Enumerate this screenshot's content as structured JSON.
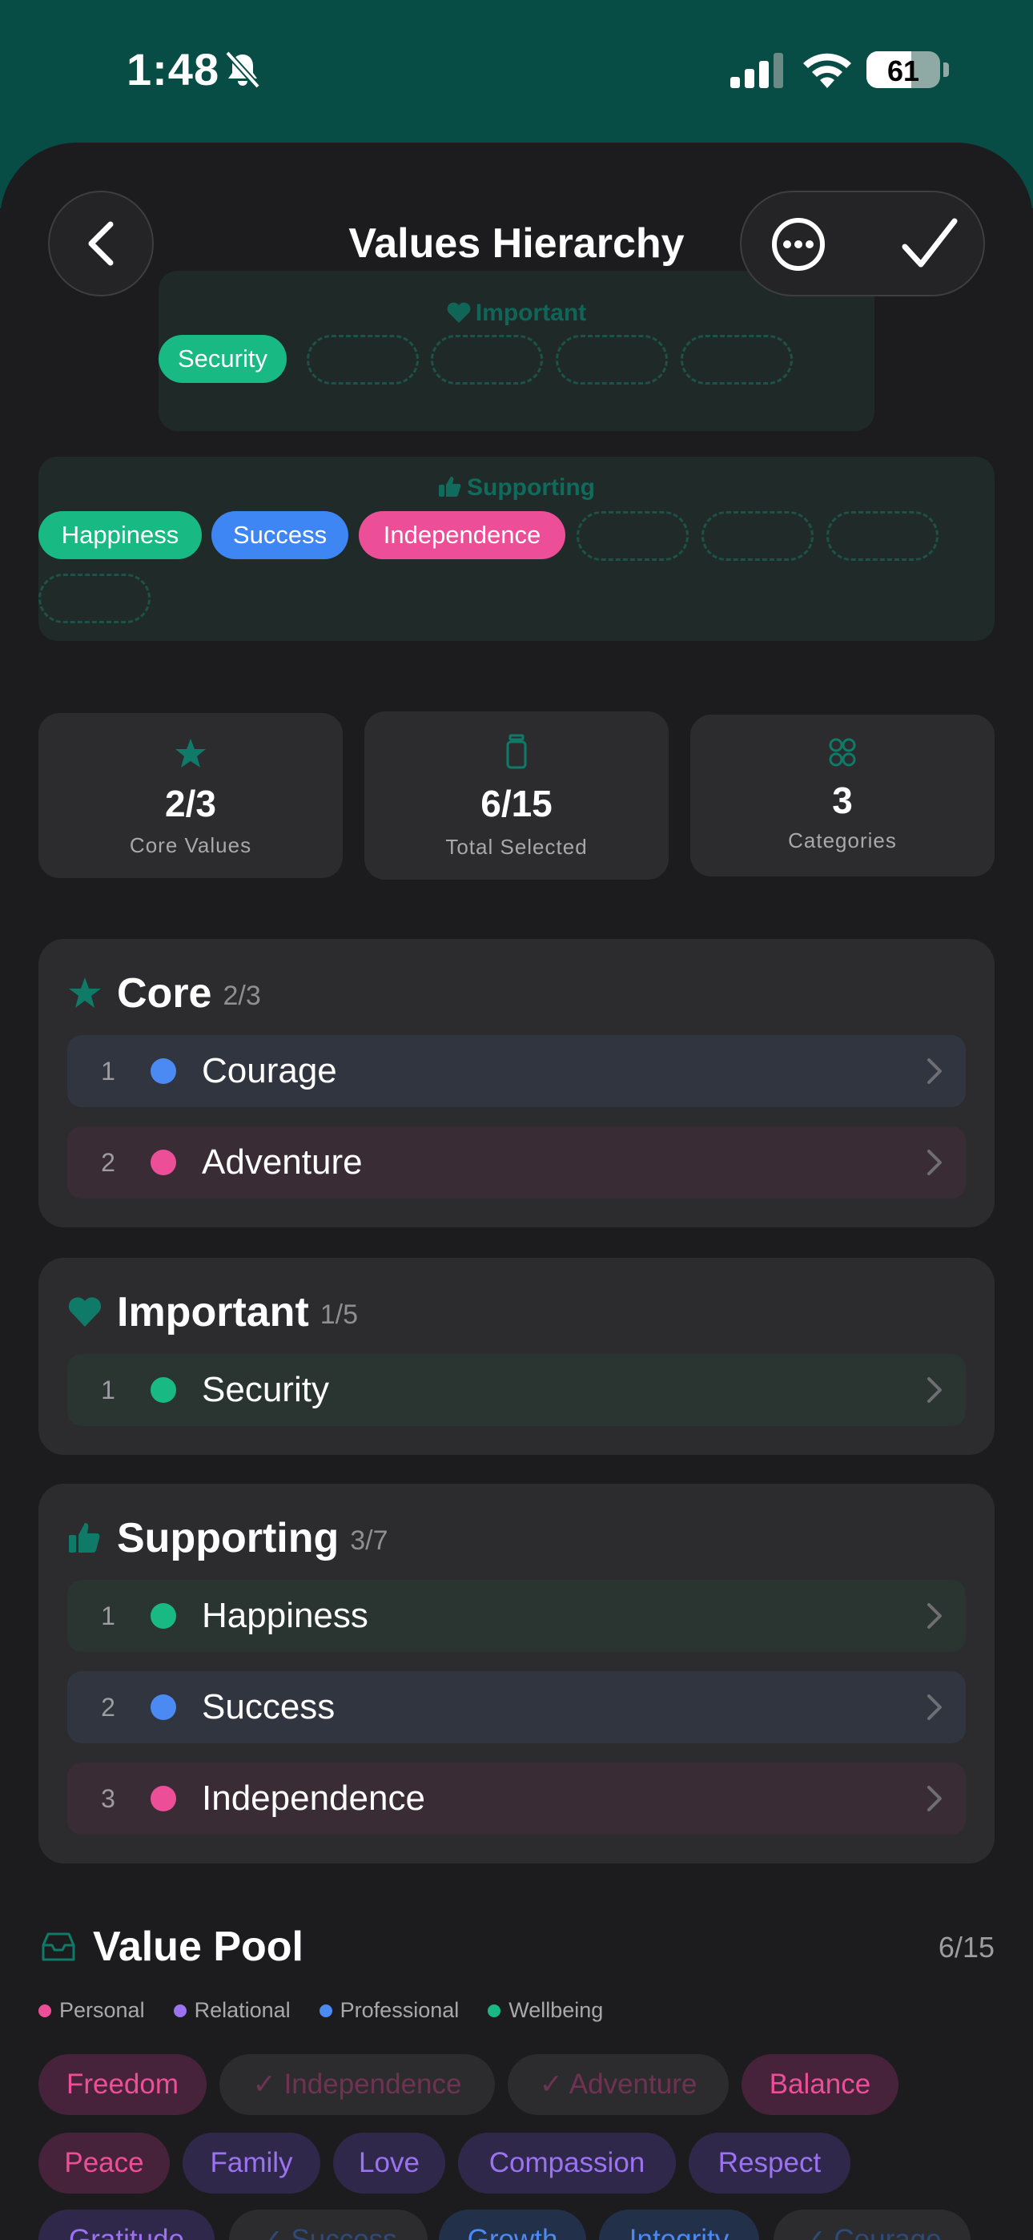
{
  "status_bar": {
    "time": "1:48",
    "battery": "61"
  },
  "header": {
    "title": "Values Hierarchy"
  },
  "pyramid": {
    "important_label": "Important",
    "important_chips": [
      "Security"
    ],
    "supporting_label": "Supporting",
    "supporting_chips": [
      "Happiness",
      "Success",
      "Independence"
    ]
  },
  "stats": [
    {
      "value": "2/3",
      "label": "Core Values",
      "icon": "star-icon"
    },
    {
      "value": "6/15",
      "label": "Total Selected",
      "icon": "jar-icon"
    },
    {
      "value": "3",
      "label": "Categories",
      "icon": "grid-icon"
    }
  ],
  "sections": {
    "core": {
      "title": "Core",
      "count": "2/3",
      "rows": [
        {
          "num": "1",
          "label": "Courage",
          "category": "professional"
        },
        {
          "num": "2",
          "label": "Adventure",
          "category": "personal"
        }
      ]
    },
    "important": {
      "title": "Important",
      "count": "1/5",
      "rows": [
        {
          "num": "1",
          "label": "Security",
          "category": "wellbeing"
        }
      ]
    },
    "supporting": {
      "title": "Supporting",
      "count": "3/7",
      "rows": [
        {
          "num": "1",
          "label": "Happiness",
          "category": "wellbeing"
        },
        {
          "num": "2",
          "label": "Success",
          "category": "professional"
        },
        {
          "num": "3",
          "label": "Independence",
          "category": "personal"
        }
      ]
    }
  },
  "value_pool": {
    "title": "Value Pool",
    "count": "6/15",
    "legend": [
      "Personal",
      "Relational",
      "Professional",
      "Wellbeing"
    ],
    "chips": [
      {
        "label": "Freedom"
      },
      {
        "label": "✓ Independence"
      },
      {
        "label": "✓ Adventure"
      },
      {
        "label": "Balance"
      },
      {
        "label": "Peace"
      },
      {
        "label": "Family"
      },
      {
        "label": "Love"
      },
      {
        "label": "Compassion"
      },
      {
        "label": "Respect"
      },
      {
        "label": "Gratitude"
      },
      {
        "label": "✓ Success"
      },
      {
        "label": "Growth"
      },
      {
        "label": "Integrity"
      },
      {
        "label": "✓ Courage"
      }
    ]
  },
  "colors": {
    "accent": "#0f6b5c",
    "personal": "#ec4f98",
    "relational": "#9b72f0",
    "professional": "#4b8af2",
    "wellbeing": "#19b983"
  }
}
